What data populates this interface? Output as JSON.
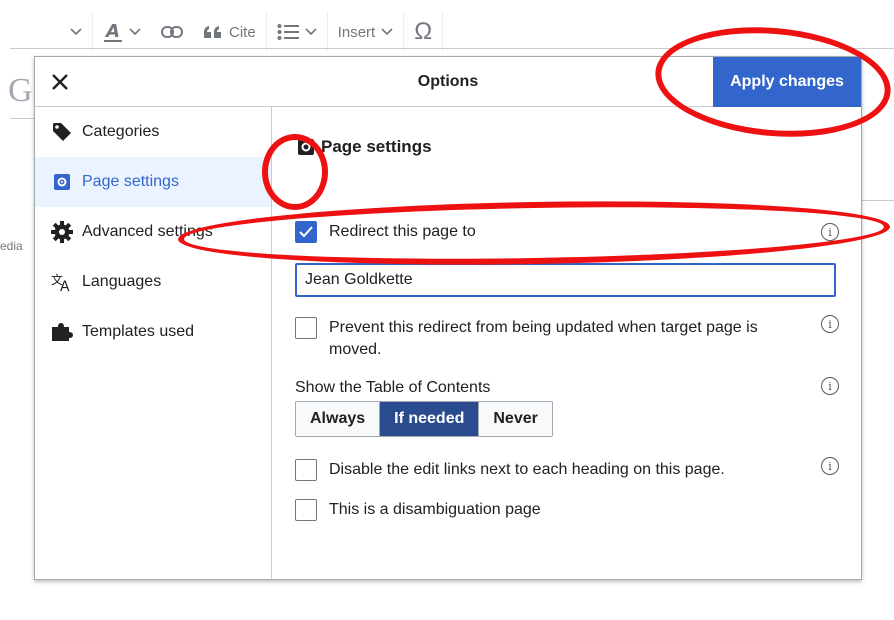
{
  "toolbar": {
    "cite_label": "Cite",
    "insert_label": "Insert",
    "omega_label": "Ω"
  },
  "background": {
    "title_letter": "G",
    "side_fragment": "edia"
  },
  "dialog": {
    "title": "Options",
    "apply_label": "Apply changes"
  },
  "sidebar": {
    "items": [
      {
        "label": "Categories",
        "icon": "tag-icon"
      },
      {
        "label": "Page settings",
        "icon": "page-settings-icon",
        "active": true
      },
      {
        "label": "Advanced settings",
        "icon": "gear-icon"
      },
      {
        "label": "Languages",
        "icon": "language-icon"
      },
      {
        "label": "Templates used",
        "icon": "puzzle-icon"
      }
    ]
  },
  "page_settings": {
    "heading": "Page settings",
    "redirect_label": "Redirect this page to",
    "redirect_checked": true,
    "redirect_value": "Jean Goldkette",
    "prevent_label_line1": "Prevent this redirect from being updated when target page is",
    "prevent_label_line2": "moved.",
    "toc_label": "Show the Table of Contents",
    "toc_options": [
      "Always",
      "If needed",
      "Never"
    ],
    "toc_selected": "If needed",
    "disable_edit_label": "Disable the edit links next to each heading on this page.",
    "disambig_label": "This is a disambiguation page"
  },
  "colors": {
    "accent": "#3366cc",
    "toggle_selected": "#2a4b8d",
    "annotation": "#ee1111"
  }
}
